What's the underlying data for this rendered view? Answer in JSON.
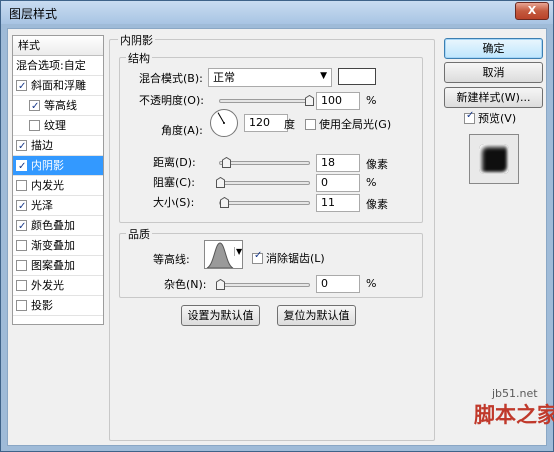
{
  "window": {
    "title": "图层样式",
    "close_label": "X"
  },
  "sidebar": {
    "header": "样式",
    "blend_item": "混合选项:自定",
    "items": [
      {
        "label": "斜面和浮雕",
        "checked": true
      },
      {
        "label": "等高线",
        "checked": true
      },
      {
        "label": "纹理",
        "checked": false
      },
      {
        "label": "描边",
        "checked": true
      },
      {
        "label": "内阴影",
        "checked": true
      },
      {
        "label": "内发光",
        "checked": false
      },
      {
        "label": "光泽",
        "checked": true
      },
      {
        "label": "颜色叠加",
        "checked": true
      },
      {
        "label": "渐变叠加",
        "checked": false
      },
      {
        "label": "图案叠加",
        "checked": false
      },
      {
        "label": "外发光",
        "checked": false
      },
      {
        "label": "投影",
        "checked": false
      }
    ]
  },
  "panel": {
    "title": "内阴影",
    "structure": {
      "title": "结构",
      "blend_mode_label": "混合模式(B):",
      "blend_mode_value": "正常",
      "opacity_label": "不透明度(O):",
      "opacity_value": "100",
      "opacity_unit": "%",
      "opacity_fraction": 1.0,
      "angle_label": "角度(A):",
      "angle_value": "120",
      "angle_unit": "度",
      "global_light_label": "使用全局光(G)",
      "global_light_checked": false,
      "distance_label": "距离(D):",
      "distance_value": "18",
      "distance_unit": "像素",
      "distance_fraction": 0.072,
      "choke_label": "阻塞(C):",
      "choke_value": "0",
      "choke_unit": "%",
      "choke_fraction": 0.0,
      "size_label": "大小(S):",
      "size_value": "11",
      "size_unit": "像素",
      "size_fraction": 0.044
    },
    "quality": {
      "title": "品质",
      "contour_label": "等高线:",
      "antialias_label": "消除锯齿(L)",
      "antialias_checked": true,
      "noise_label": "杂色(N):",
      "noise_value": "0",
      "noise_unit": "%",
      "noise_fraction": 0.0
    },
    "set_default_label": "设置为默认值",
    "reset_default_label": "复位为默认值"
  },
  "actions": {
    "ok_label": "确定",
    "cancel_label": "取消",
    "new_style_label": "新建样式(W)...",
    "preview_label": "预览(V)",
    "preview_checked": true
  },
  "watermark": {
    "site": "jb51.net",
    "brand": "脚本之家"
  },
  "colors": {
    "selection": "#3399ff",
    "shadow_color": "#ffffff"
  }
}
